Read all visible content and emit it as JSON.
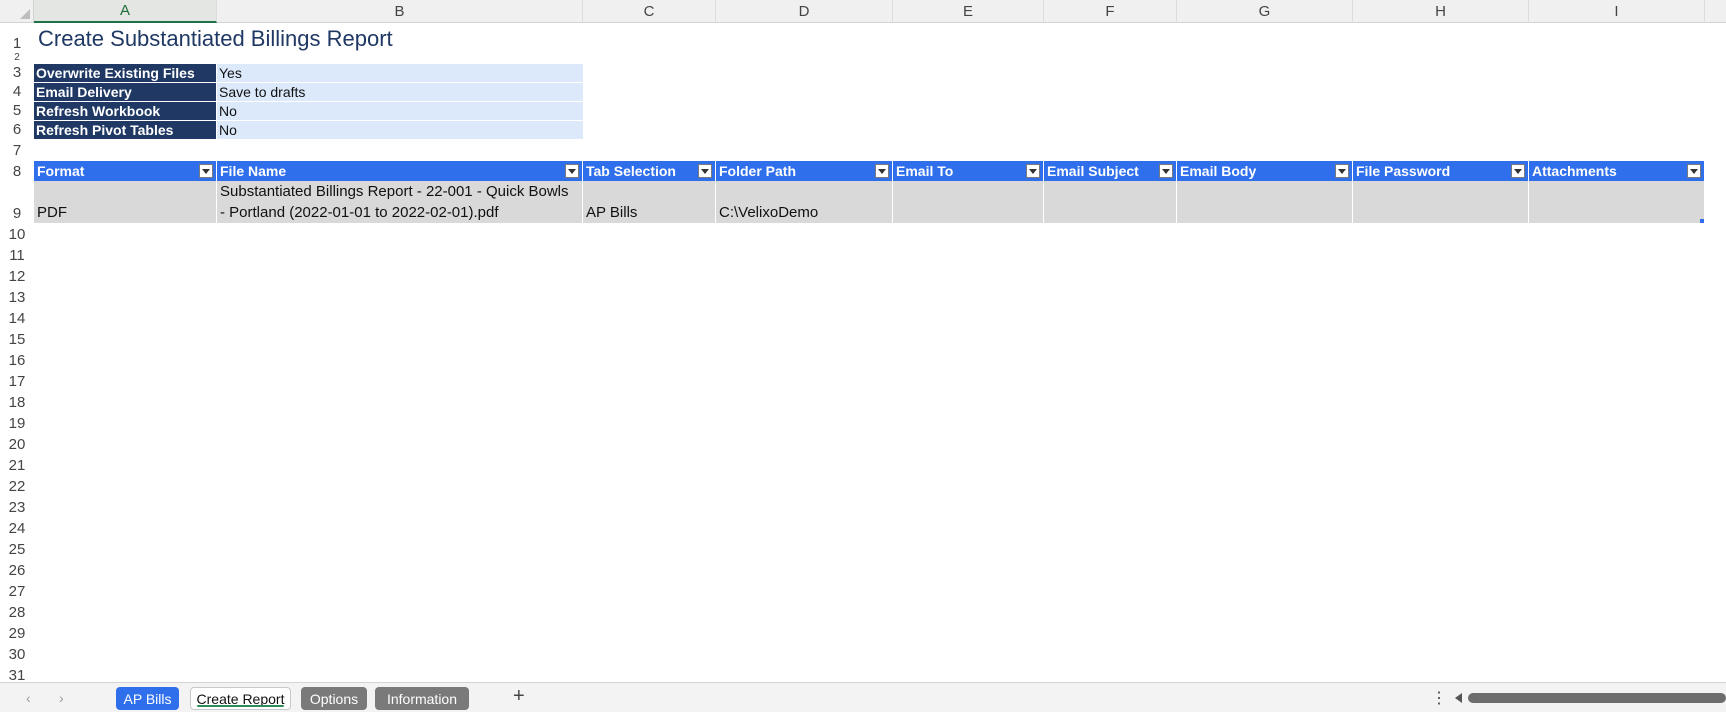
{
  "columns": [
    "A",
    "B",
    "C",
    "D",
    "E",
    "F",
    "G",
    "H",
    "I"
  ],
  "rows": [
    "1",
    "2",
    "3",
    "4",
    "5",
    "6",
    "7",
    "8",
    "9",
    "10",
    "11",
    "12",
    "13",
    "14",
    "15",
    "16",
    "17",
    "18",
    "19",
    "20",
    "21",
    "22",
    "23",
    "24",
    "25",
    "26",
    "27",
    "28",
    "29",
    "30",
    "31"
  ],
  "title": "Create Substantiated Billings Report",
  "options": [
    {
      "label": "Overwrite Existing Files",
      "value": "Yes"
    },
    {
      "label": "Email Delivery",
      "value": "Save to drafts"
    },
    {
      "label": "Refresh Workbook",
      "value": "No"
    },
    {
      "label": "Refresh Pivot Tables",
      "value": "No"
    }
  ],
  "table": {
    "headers": [
      "Format",
      "File Name",
      "Tab Selection",
      "Folder Path",
      "Email To",
      "Email Subject",
      "Email Body",
      "File Password",
      "Attachments"
    ],
    "row": {
      "format": "PDF",
      "file_name_line1": "Substantiated Billings Report - 22-001 - Quick Bowls",
      "file_name_line2": "- Portland (2022-01-01 to 2022-02-01).pdf",
      "tab_selection": "AP Bills",
      "folder_path": "C:\\VelixoDemo",
      "email_to": "",
      "email_subject": "",
      "email_body": "",
      "file_password": "",
      "attachments": ""
    }
  },
  "sheet_tabs": [
    {
      "label": "AP Bills",
      "state": "blue"
    },
    {
      "label": "Create Report",
      "state": "active"
    },
    {
      "label": "Options",
      "state": "gray"
    },
    {
      "label": "Information",
      "state": "gray"
    }
  ],
  "colors": {
    "header_blue": "#2f6fec",
    "navy": "#1f3864",
    "option_value_bg": "#dbe9fb",
    "data_row_bg": "#d9d9d9"
  }
}
